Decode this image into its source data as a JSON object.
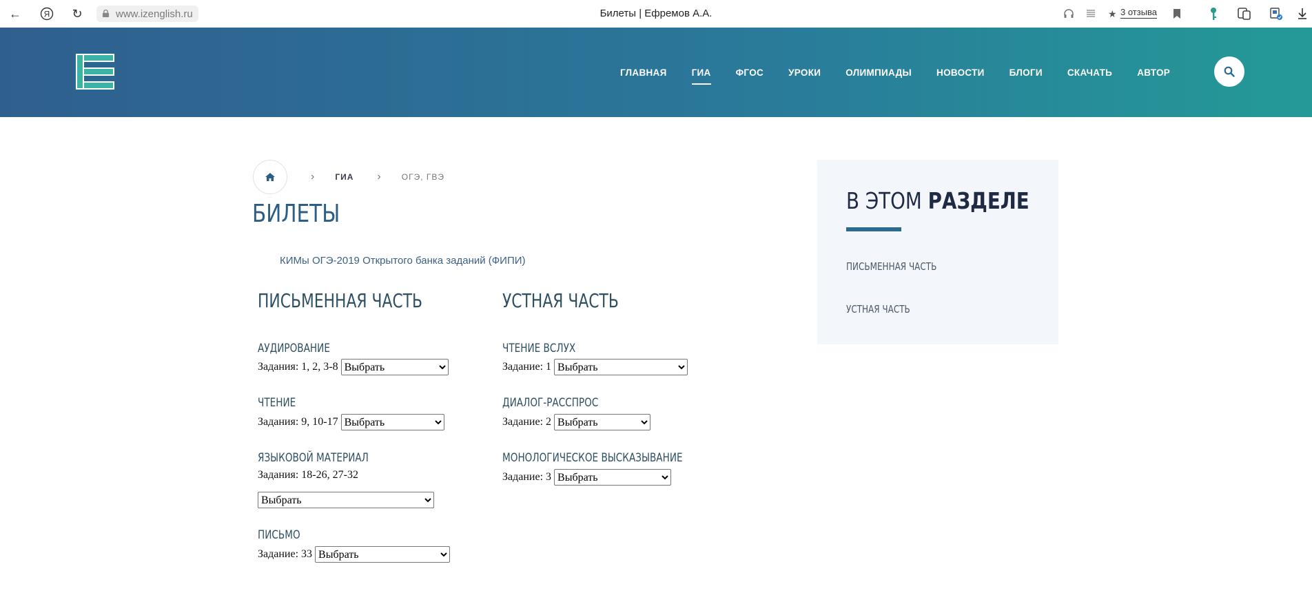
{
  "browser": {
    "url": "www.izenglish.ru",
    "tab_title": "Билеты | Ефремов А.А.",
    "reviews": "3 отзыва"
  },
  "nav": {
    "items": [
      "ГЛАВНАЯ",
      "ГИА",
      "ФГОС",
      "УРОКИ",
      "ОЛИМПИАДЫ",
      "НОВОСТИ",
      "БЛОГИ",
      "СКАЧАТЬ",
      "АВТОР"
    ],
    "active": "ГИА"
  },
  "breadcrumb": {
    "level1": "ГИА",
    "level2": "ОГЭ, ГВЭ"
  },
  "page": {
    "title": "БИЛЕТЫ",
    "intro_link": "КИМы ОГЭ-2019 Открытого банка заданий (ФИПИ)"
  },
  "written": {
    "title": "ПИСЬМЕННАЯ ЧАСТЬ",
    "listening": {
      "title": "АУДИРОВАНИЕ",
      "tasks": "Задания: 1, 2, 3-8",
      "select": "Выбрать"
    },
    "reading": {
      "title": "ЧТЕНИЕ",
      "tasks": "Задания: 9, 10-17",
      "select": "Выбрать"
    },
    "language": {
      "title": "ЯЗЫКОВОЙ МАТЕРИАЛ",
      "tasks": "Задания: 18-26, 27-32",
      "select": "Выбрать"
    },
    "letter": {
      "title": "ПИСЬМО",
      "tasks": "Задание: 33",
      "select": "Выбрать"
    }
  },
  "oral": {
    "title": "УСТНАЯ ЧАСТЬ",
    "reading_aloud": {
      "title": "ЧТЕНИЕ ВСЛУХ",
      "tasks": "Задание: 1",
      "select": "Выбрать"
    },
    "dialogue": {
      "title": "ДИАЛОГ-РАССПРОС",
      "tasks": "Задание: 2",
      "select": "Выбрать"
    },
    "monologue": {
      "title": "МОНОЛОГИЧЕСКОЕ ВЫСКАЗЫВАНИЕ",
      "tasks": "Задание: 3",
      "select": "Выбрать"
    }
  },
  "sidebar": {
    "title_light": "В ЭТОМ",
    "title_bold": "РАЗДЕЛЕ",
    "links": [
      "ПИСЬМЕННАЯ ЧАСТЬ",
      "УСТНАЯ ЧАСТЬ"
    ]
  },
  "colors": {
    "header_start": "#2f5f8e",
    "header_end": "#249a98",
    "title_blue": "#2c5d84",
    "section_text": "#2f4f63",
    "sidebar_bg": "#f3f6fb",
    "accent_rule": "#2c6a8e"
  }
}
